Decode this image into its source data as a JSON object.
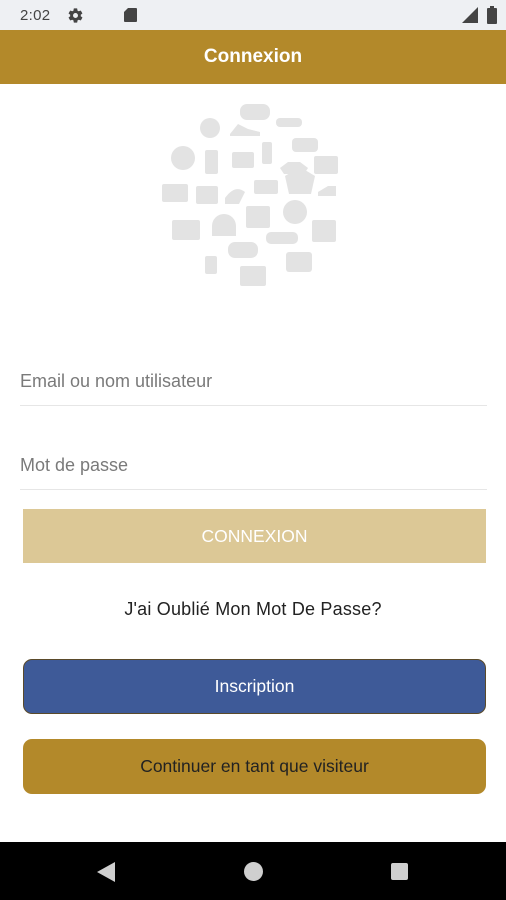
{
  "status_bar": {
    "time": "2:02",
    "icons": [
      "settings-gear-icon",
      "sd-card-icon",
      "cell-signal-icon",
      "battery-icon"
    ]
  },
  "header": {
    "title": "Connexion"
  },
  "logo": {
    "icon": "shopping-categories-collage-icon"
  },
  "form": {
    "email_placeholder": "Email ou nom utilisateur",
    "email_value": "",
    "password_placeholder": "Mot de passe",
    "password_value": "",
    "submit_label": "CONNEXION",
    "forgot_label": "J'ai Oublié Mon Mot De Passe?"
  },
  "actions": {
    "register_label": "Inscription",
    "guest_label": "Continuer en tant que visiteur"
  },
  "nav_bar": {
    "icons": [
      "back-icon",
      "home-icon",
      "recents-icon"
    ]
  },
  "colors": {
    "brand_gold": "#b3892a",
    "button_disabled": "#dcc896",
    "register_blue": "#3e5a98",
    "logo_gray": "#e3e3e3"
  }
}
